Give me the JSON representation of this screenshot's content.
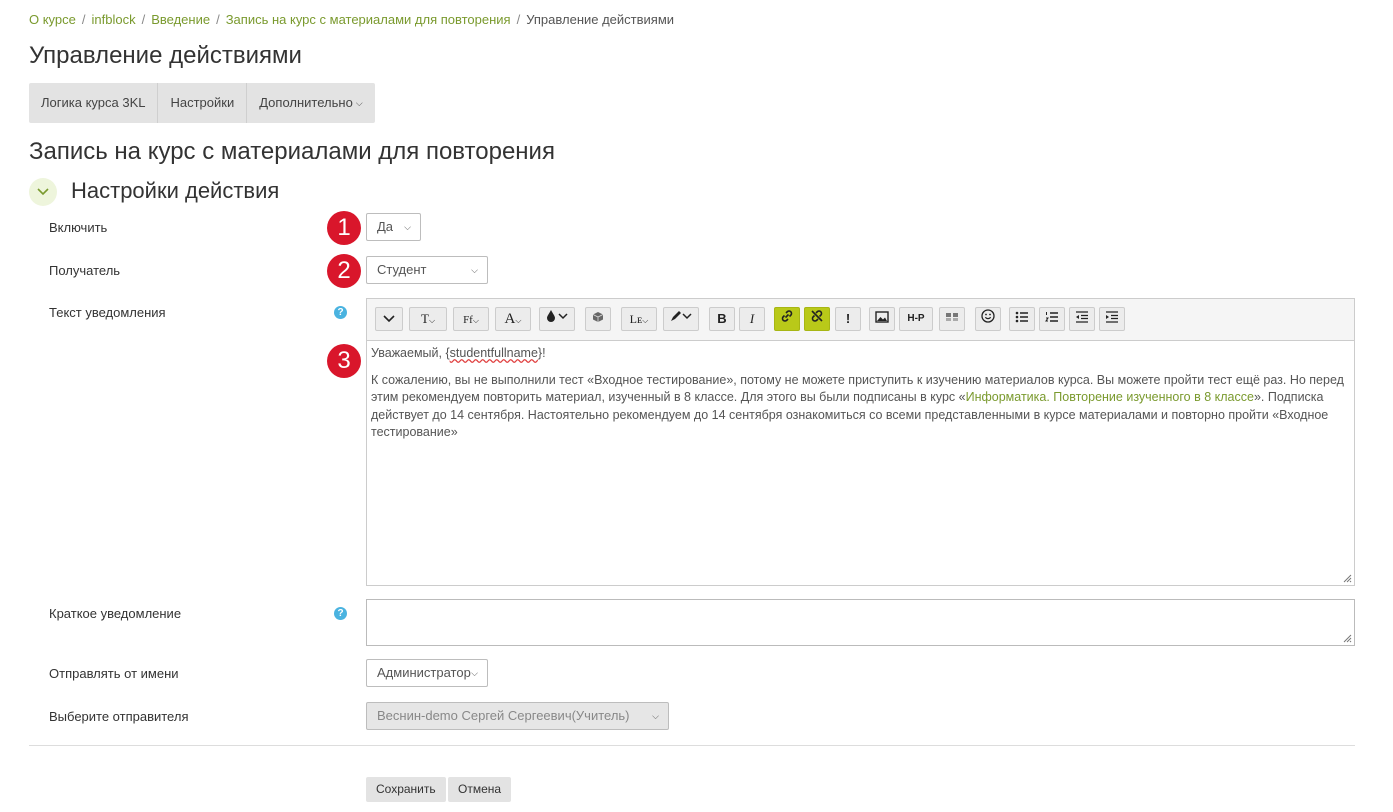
{
  "breadcrumb": {
    "items": [
      "О курсе",
      "infblock",
      "Введение",
      "Запись на курс с материалами для повторения"
    ],
    "current": "Управление действиями",
    "separator": "/"
  },
  "page_title": "Управление действиями",
  "nav": {
    "logic": "Логика курса 3KL",
    "settings": "Настройки",
    "more": "Дополнительно"
  },
  "section_title": "Запись на курс с материалами для повторения",
  "fieldset_title": "Настройки действия",
  "form": {
    "enable": {
      "label": "Включить",
      "value": "Да"
    },
    "recipient": {
      "label": "Получатель",
      "value": "Студент"
    },
    "notification_text": {
      "label": "Текст уведомления",
      "greeting_prefix": "Уважаемый, {",
      "greeting_var": "studentfullname",
      "greeting_suffix": "}!",
      "body_1": "К сожалению, вы не выполнили тест «Входное тестирование», потому не можете приступить к изучению материалов курса. Вы можете пройти тест ещё раз. Но перед этим рекомендуем повторить материал, изученный в 8 классе. Для этого вы были подписаны в курс «",
      "body_link": "Информатика. Повторение изученного в 8 классе",
      "body_2": "». Подписка действует до 14 сентября. Настоятельно рекомендуем до 14 сентября ознакомиться со всеми представленными в курсе материалами и повторно пройти «Входное тестирование»"
    },
    "short_notification": {
      "label": "Краткое уведомление",
      "value": ""
    },
    "send_as": {
      "label": "Отправлять от имени",
      "value": "Администратор"
    },
    "sender": {
      "label": "Выберите отправителя",
      "value": "Веснин-demo Сергей Сергеевич(Учитель)"
    }
  },
  "markers": [
    "1",
    "2",
    "3"
  ],
  "help_icon": "?",
  "toolbar": {
    "bold": "B",
    "italic": "I",
    "important": "!",
    "h5p": "H-P",
    "text_size": "T",
    "font_family": "Ff",
    "font_color": "A",
    "multilang": "Lᴇ"
  },
  "buttons": {
    "save": "Сохранить",
    "cancel": "Отмена"
  },
  "colors": {
    "link": "#7a9a2e",
    "marker": "#d9162b",
    "active_tool": "#b9c919",
    "help": "#4ab3e0"
  }
}
